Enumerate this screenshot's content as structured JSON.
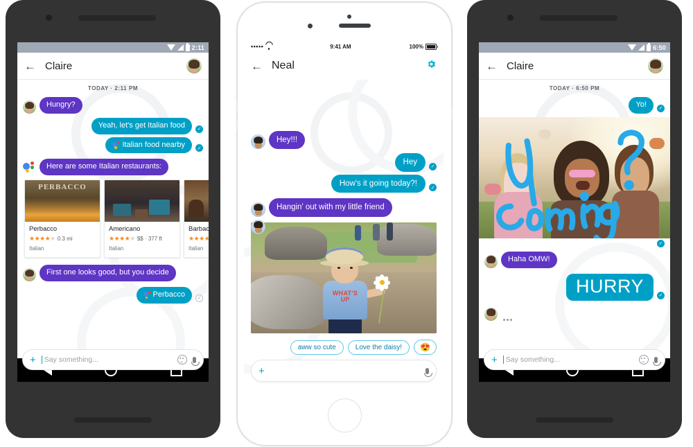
{
  "phones": {
    "left": {
      "device": "android",
      "status": {
        "time": "2:11",
        "icons": [
          "wifi-icon",
          "signal-icon",
          "battery-icon"
        ]
      },
      "appbar": {
        "back": "←",
        "title": "Claire"
      },
      "daystamp": "TODAY · 2:11 PM",
      "messages": [
        {
          "id": "m1",
          "dir": "in",
          "text": "Hungry?",
          "avatar": "claire"
        },
        {
          "id": "m2",
          "dir": "out",
          "text": "Yeah, let's get Italian food",
          "tick": "teal"
        },
        {
          "id": "m3",
          "dir": "out",
          "text": "Italian food nearby",
          "assistant": true,
          "tick": "teal"
        },
        {
          "id": "m4",
          "dir": "assistant",
          "text": "Here are some Italian restaurants:"
        },
        {
          "id": "m5",
          "dir": "in",
          "text": "First one looks good, but you decide",
          "avatar": "claire"
        },
        {
          "id": "m6",
          "dir": "out",
          "text": "Perbacco",
          "assistant": true,
          "tick": "grey"
        }
      ],
      "cards": [
        {
          "name": "Perbacco",
          "stars": 4,
          "price": "",
          "distance": "0.3 mi",
          "meta": "0.3 mi",
          "cuisine": "Italian"
        },
        {
          "name": "Americano",
          "stars": 4,
          "price": "$$",
          "distance": "377 ft",
          "meta": "$$ · 377 ft",
          "cuisine": "Italian"
        },
        {
          "name": "Barbacco",
          "stars": 4,
          "price": "$",
          "distance": "",
          "meta": "$",
          "cuisine": "Italian"
        }
      ],
      "composer": {
        "plus": "+",
        "placeholder": "Say something...",
        "emoji": "emoji-icon",
        "mic": "mic-icon"
      },
      "navbar": {
        "back": "back-icon",
        "home": "home-icon",
        "recents": "recents-icon"
      }
    },
    "middle": {
      "device": "iphone",
      "status": {
        "carrier_dots": "•••••",
        "time": "9:41 AM",
        "battery": "100%"
      },
      "appbar": {
        "back": "←",
        "title": "Neal",
        "settings": "gear-icon"
      },
      "messages": [
        {
          "id": "n1",
          "dir": "in",
          "text": "Hey!!!",
          "avatar": "neal"
        },
        {
          "id": "n2",
          "dir": "out",
          "text": "Hey",
          "tick": "teal"
        },
        {
          "id": "n3",
          "dir": "out",
          "text": "How's it going today?!",
          "tick": "teal"
        },
        {
          "id": "n4",
          "dir": "in",
          "text": "Hangin' out with my little friend",
          "avatar": "neal"
        },
        {
          "id": "n5",
          "dir": "in",
          "type": "photo",
          "avatar": "neal",
          "alt": "toddler in straw hat holding a daisy",
          "shirt_text_1": "WHAT'S",
          "shirt_text_2": "UP"
        }
      ],
      "smart_replies": [
        "aww so cute",
        "Love the daisy!",
        "😍"
      ],
      "composer": {
        "plus": "+",
        "placeholder": "",
        "mic": "mic-icon"
      }
    },
    "right": {
      "device": "android",
      "status": {
        "time": "6:50",
        "icons": [
          "wifi-icon",
          "signal-icon",
          "battery-icon"
        ]
      },
      "appbar": {
        "back": "←",
        "title": "Claire"
      },
      "daystamp": "TODAY · 6:50 PM",
      "messages": [
        {
          "id": "r1",
          "dir": "out",
          "text": "Yo!",
          "tick": "teal"
        },
        {
          "id": "r2",
          "dir": "out",
          "type": "photo",
          "doodle": "U Coming?",
          "doodle_color": "#28a9e8",
          "tick": "teal",
          "alt": "friends at a colour festival"
        },
        {
          "id": "r3",
          "dir": "in",
          "text": "Haha OMW!",
          "avatar": "claire"
        },
        {
          "id": "r4",
          "dir": "out",
          "type": "bigtext",
          "text": "HURRY",
          "tick": "teal"
        },
        {
          "id": "r5",
          "dir": "in",
          "type": "typing",
          "text": "…",
          "avatar": "claire"
        }
      ],
      "composer": {
        "plus": "+",
        "placeholder": "Say something...",
        "emoji": "emoji-icon",
        "mic": "mic-icon"
      },
      "navbar": {
        "back": "back-icon",
        "home": "home-icon",
        "recents": "recents-icon"
      }
    }
  },
  "colors": {
    "incoming_bubble": "#5e35c4",
    "outgoing_bubble": "#00a0c6",
    "accent": "#00a0c6",
    "doodle": "#28a9e8",
    "android_frame": "#333333",
    "status_bar": "#9fa8b4",
    "star": "#f28b1c"
  }
}
